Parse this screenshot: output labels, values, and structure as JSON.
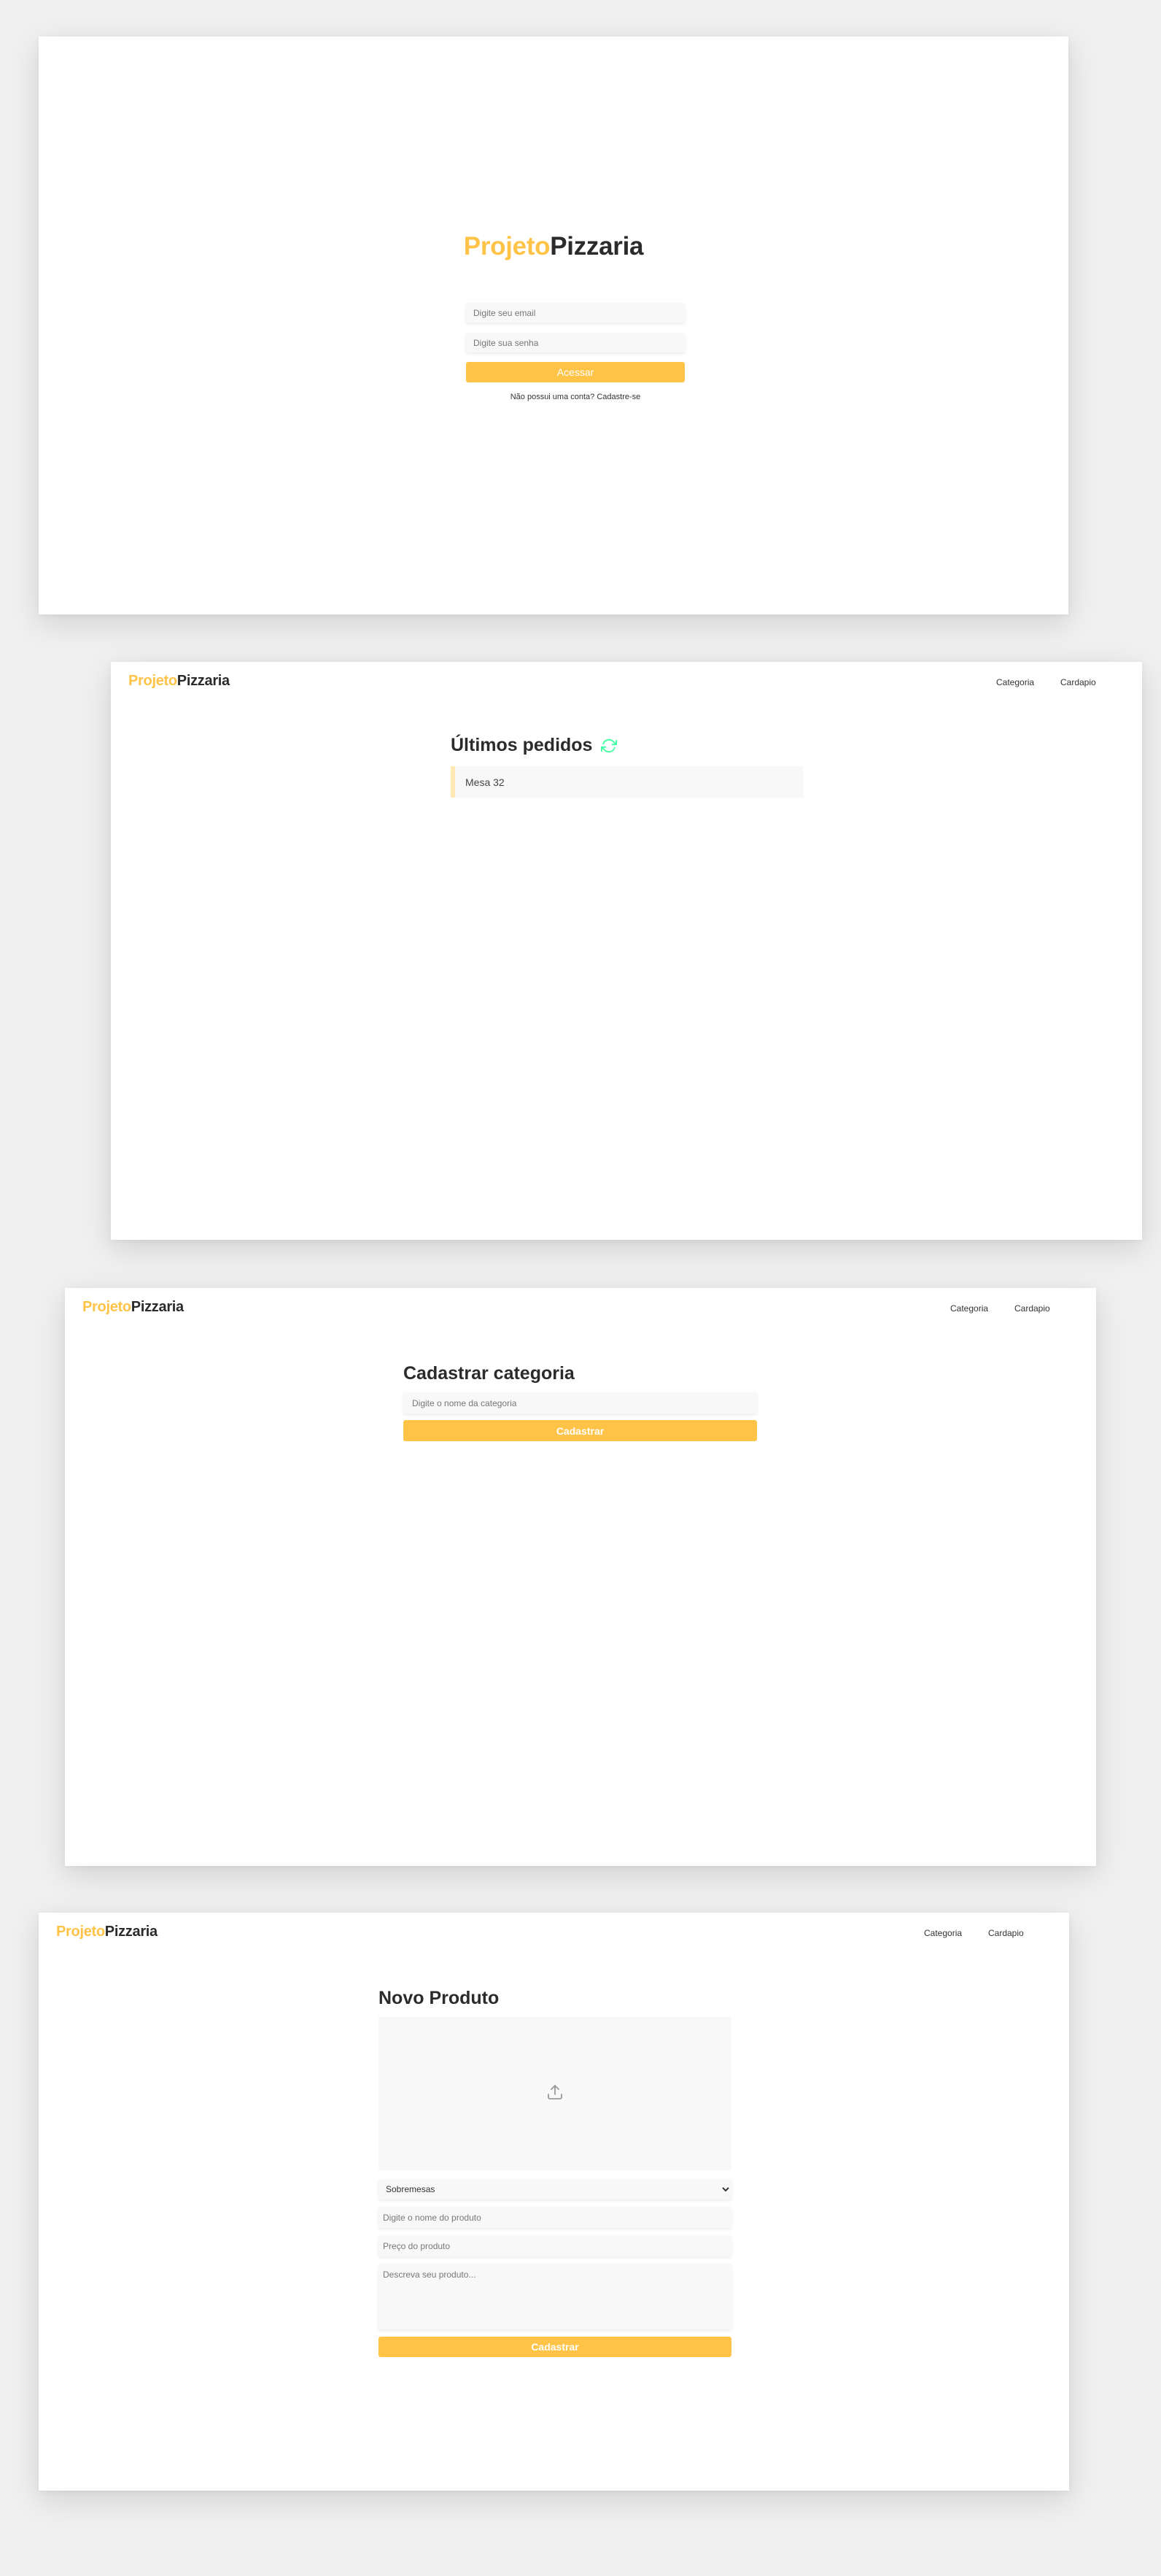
{
  "login": {
    "logo_part1": "Projeto",
    "logo_part2": "Pizzaria",
    "email_placeholder": "Digite seu email",
    "password_placeholder": "Digite sua senha",
    "submit_label": "Acessar",
    "signup_link": "Não possui uma conta? Cadastre-se"
  },
  "header": {
    "logo_part1": "Projeto",
    "logo_part2": "Pizzaria",
    "nav": [
      "Categoria",
      "Cardapio"
    ]
  },
  "dashboard": {
    "title": "Últimos pedidos",
    "refresh_icon": "refresh-icon",
    "orders": [
      {
        "label": "Mesa 32"
      }
    ]
  },
  "category": {
    "title": "Cadastrar categoria",
    "name_placeholder": "Digite o nome da categoria",
    "submit_label": "Cadastrar"
  },
  "product": {
    "title": "Novo Produto",
    "upload_icon": "upload-icon",
    "category_selected": "Sobremesas",
    "name_placeholder": "Digite o nome do produto",
    "price_placeholder": "Preço do produto",
    "description_placeholder": "Descreva seu produto...",
    "submit_label": "Cadastrar"
  },
  "colors": {
    "accent": "#ffc348",
    "refresh_icon": "#3fffa3",
    "page_background": "#f0f0f0"
  }
}
